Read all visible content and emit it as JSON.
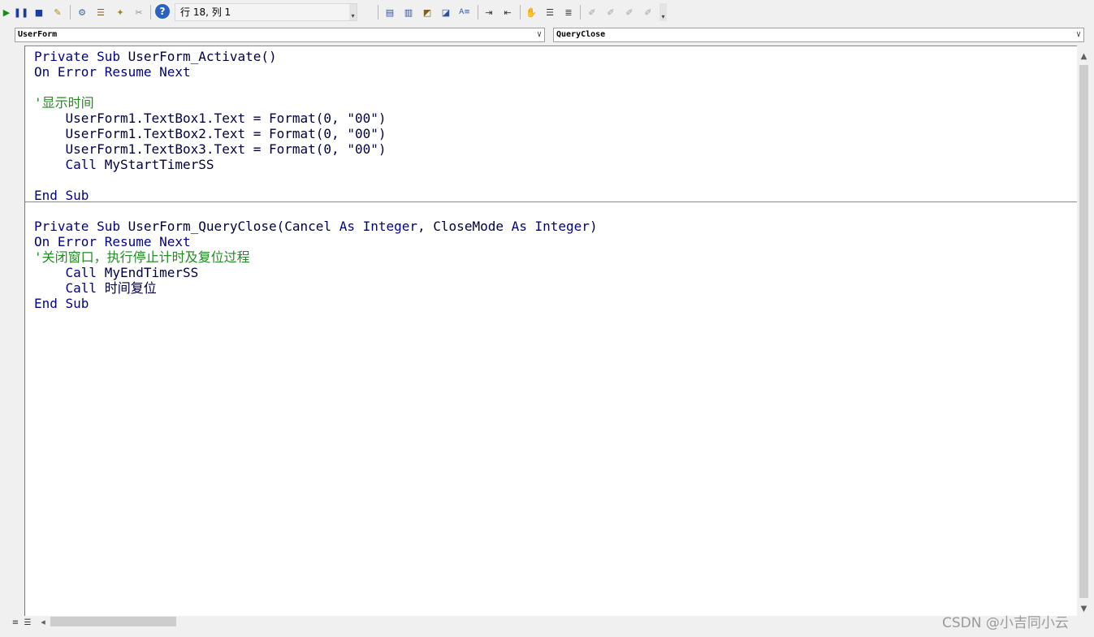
{
  "toolbar": {
    "status": "行 18, 列 1",
    "grip": "▾"
  },
  "object_dropdown": {
    "value": "UserForm",
    "arrow": "∨"
  },
  "procedure_dropdown": {
    "value": "QueryClose",
    "arrow": "∨"
  },
  "code": {
    "block1": {
      "sub_decl": [
        "Private Sub ",
        "UserForm_Activate()"
      ],
      "on_error": "On Error Resume Next",
      "comment": "'显示时间",
      "stmt1": "    UserForm1.TextBox1.Text = Format(0, \"00\")",
      "stmt2": "    UserForm1.TextBox2.Text = Format(0, \"00\")",
      "stmt3": "    UserForm1.TextBox3.Text = Format(0, \"00\")",
      "call_kw": "    Call ",
      "call_target": "MyStartTimerSS",
      "end_sub": "End Sub"
    },
    "block2": {
      "sub_kw": "Private Sub ",
      "sub_name": "UserForm_QueryClose(Cancel ",
      "as1": "As Integer",
      "mid": ", CloseMode ",
      "as2": "As Integer",
      "close": ")",
      "on_error": "On Error Resume Next",
      "comment": "'关闭窗口，执行停止计时及复位过程",
      "call1_kw": "    Call ",
      "call1_target": "MyEndTimerSS",
      "call2_kw": "    Call ",
      "call2_target": "时间复位",
      "end_sub": "End Sub"
    }
  },
  "watermark": "CSDN @小吉同小云",
  "colors": {
    "keyword": "#00008b",
    "comment": "#228b22",
    "text": "#000040"
  }
}
